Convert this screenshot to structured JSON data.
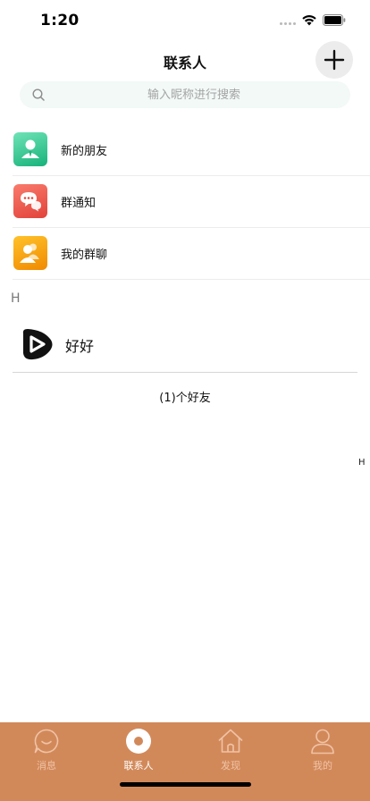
{
  "status_bar": {
    "time": "1:20"
  },
  "header": {
    "title": "联系人"
  },
  "search": {
    "placeholder": "输入昵称进行搜索",
    "value": ""
  },
  "menu": [
    {
      "label": "新的朋友",
      "icon": "new-friend-icon",
      "color": "#2bbf8a"
    },
    {
      "label": "群通知",
      "icon": "group-notice-icon",
      "color": "#ec5548"
    },
    {
      "label": "我的群聊",
      "icon": "group-chat-icon",
      "color": "#f7a20f"
    }
  ],
  "contacts": {
    "section_letter": "H",
    "items": [
      {
        "name": "好好",
        "avatar": "play-logo-avatar"
      }
    ],
    "count_text": "(1)个好友"
  },
  "index_bar": [
    "H"
  ],
  "tabs": [
    {
      "label": "消息",
      "icon": "chat-bubble-icon",
      "active": false
    },
    {
      "label": "联系人",
      "icon": "contacts-record-icon",
      "active": true
    },
    {
      "label": "发现",
      "icon": "home-icon",
      "active": false
    },
    {
      "label": "我的",
      "icon": "person-icon",
      "active": false
    }
  ],
  "colors": {
    "tab_bar": "#d2895a",
    "search_bg": "#f2f9f7",
    "add_button_bg": "#ececec"
  }
}
